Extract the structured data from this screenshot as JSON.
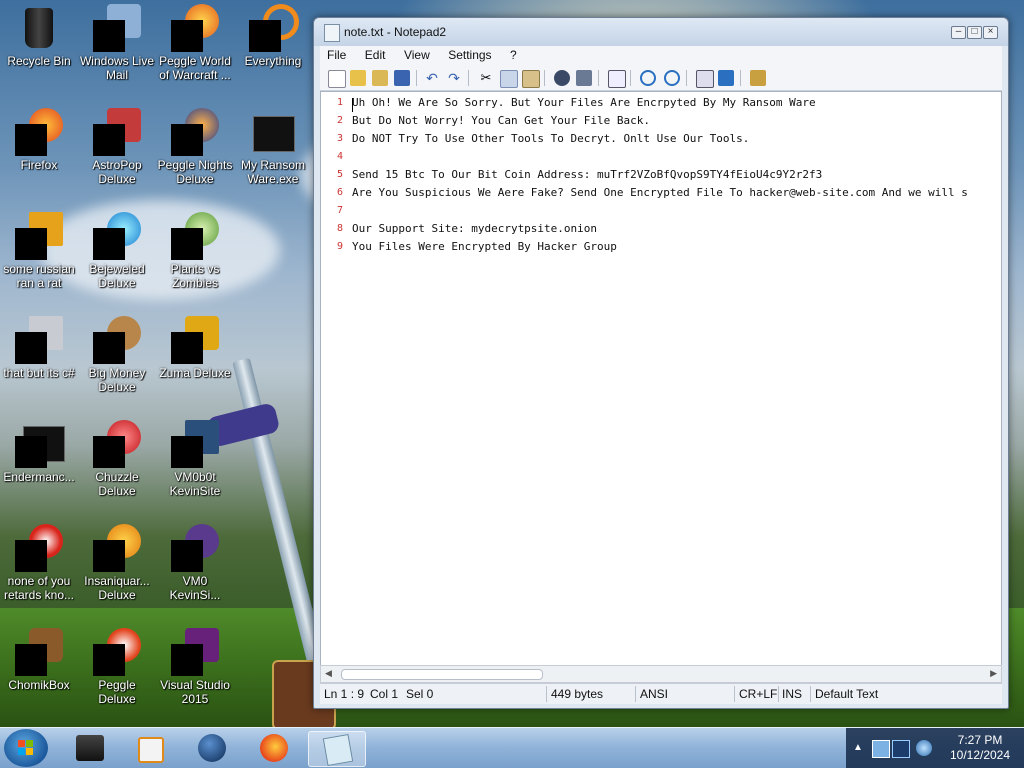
{
  "desktop": {
    "icons": [
      {
        "label": "Recycle Bin"
      },
      {
        "label": "Windows Live Mail"
      },
      {
        "label": "Peggle World of Warcraft ..."
      },
      {
        "label": "Everything"
      },
      {
        "label": "Firefox"
      },
      {
        "label": "AstroPop Deluxe"
      },
      {
        "label": "Peggle Nights Deluxe"
      },
      {
        "label": "My Ransom Ware.exe"
      },
      {
        "label": "some russian ran a rat"
      },
      {
        "label": "Bejeweled Deluxe"
      },
      {
        "label": "Plants vs Zombies"
      },
      {
        "label": "that but its c#"
      },
      {
        "label": "Big Money Deluxe"
      },
      {
        "label": "Zuma Deluxe"
      },
      {
        "label": "Endermanc..."
      },
      {
        "label": "Chuzzle Deluxe"
      },
      {
        "label": "VM0b0t KevinSite"
      },
      {
        "label": "none of you retards kno..."
      },
      {
        "label": "Insaniquar... Deluxe"
      },
      {
        "label": "VM0 KevinSi..."
      },
      {
        "label": "ChomikBox"
      },
      {
        "label": "Peggle Deluxe"
      },
      {
        "label": "Visual Studio 2015"
      }
    ]
  },
  "window": {
    "title": "note.txt - Notepad2",
    "menu": [
      "File",
      "Edit",
      "View",
      "Settings",
      "?"
    ],
    "lines": [
      {
        "num": "1",
        "text": "Uh Oh! We Are So Sorry. But Your Files Are Encrpyted By My Ransom Ware"
      },
      {
        "num": "2",
        "text": "But Do Not Worry! You Can Get Your File Back."
      },
      {
        "num": "3",
        "text": "Do NOT Try To Use Other Tools To Decryt. Onlt Use Our Tools."
      },
      {
        "num": "4",
        "text": ""
      },
      {
        "num": "5",
        "text": "Send 15 Btc To Our Bit Coin Address: muTrf2VZoBfQvopS9TY4fEioU4c9Y2r2f3"
      },
      {
        "num": "6",
        "text": "Are You Suspicious We Aere Fake? Send One Encrypted File To hacker@web-site.com And we will s"
      },
      {
        "num": "7",
        "text": ""
      },
      {
        "num": "8",
        "text": "Our Support Site: mydecrytpsite.onion"
      },
      {
        "num": "9",
        "text": "You Files Were Encrypted By Hacker Group"
      }
    ],
    "status": {
      "position": "Ln 1 : 9",
      "col": "Col 1",
      "sel": "Sel 0",
      "size": "449 bytes",
      "encoding": "ANSI",
      "eol": "CR+LF",
      "mode": "INS",
      "scheme": "Default Text"
    }
  },
  "taskbar": {
    "clock_time": "7:27 PM",
    "clock_date": "10/12/2024"
  },
  "colors": {
    "accent": "#1d5a9d",
    "line_number": "#cc3333"
  }
}
